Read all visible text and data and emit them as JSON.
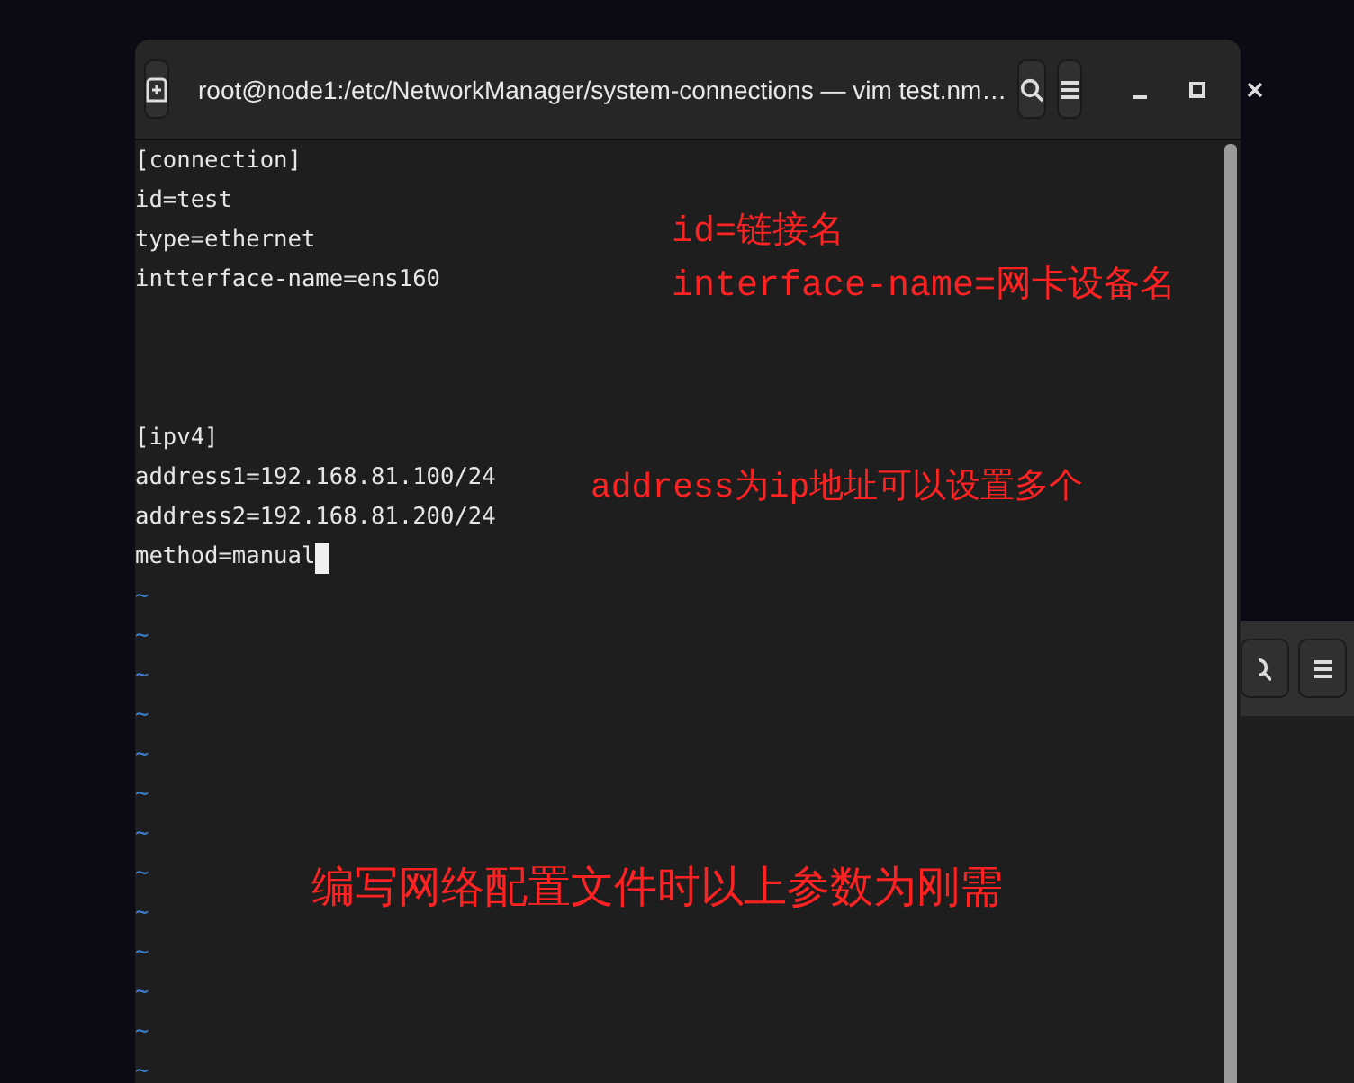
{
  "terminal": {
    "title": "root@node1:/etc/NetworkManager/system-connections — vim test.nm…",
    "sections": [
      {
        "lines": [
          {
            "text": "[connection]",
            "cursor": false
          },
          {
            "text": "id=test",
            "cursor": false
          },
          {
            "text": "type=ethernet",
            "cursor": false
          },
          {
            "text": "intterface-name=ens160",
            "cursor": false
          }
        ]
      },
      {
        "lines": [
          {
            "text": "[ipv4]",
            "cursor": false
          },
          {
            "text": "address1=192.168.81.100/24",
            "cursor": false
          },
          {
            "text": "address2=192.168.81.200/24",
            "cursor": false
          },
          {
            "text": "method=manual",
            "cursor": true
          }
        ]
      }
    ],
    "tildes": [
      "~",
      "~",
      "~",
      "~",
      "~",
      "~",
      "~",
      "~",
      "~",
      "~",
      "~",
      "~",
      "~"
    ]
  },
  "annotations": [
    {
      "text": "id=链接名"
    },
    {
      "text": "interface-name=网卡设备名"
    },
    {
      "text": "address为ip地址可以设置多个"
    },
    {
      "text": "编写网络配置文件时以上参数为刚需"
    }
  ]
}
